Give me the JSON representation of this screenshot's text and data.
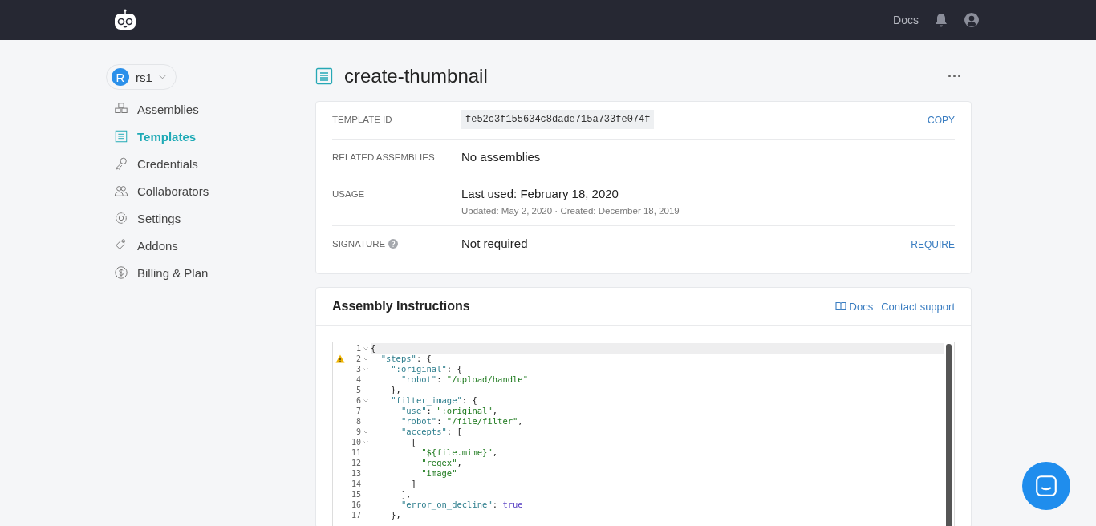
{
  "topbar": {
    "links": [
      "Docs"
    ]
  },
  "account": {
    "initial": "R",
    "name": "rs1"
  },
  "sidebar": {
    "items": [
      {
        "label": "Assemblies",
        "selected": false
      },
      {
        "label": "Templates",
        "selected": true
      },
      {
        "label": "Credentials",
        "selected": false
      },
      {
        "label": "Collaborators",
        "selected": false
      },
      {
        "label": "Settings",
        "selected": false
      },
      {
        "label": "Addons",
        "selected": false
      },
      {
        "label": "Billing & Plan",
        "selected": false
      }
    ]
  },
  "page": {
    "title": "create-thumbnail",
    "more": "···"
  },
  "details": [
    {
      "label": "TEMPLATE ID",
      "kind": "code",
      "help": false,
      "value": "fe52c3f155634c8dade715a733fe074f",
      "action": "COPY"
    },
    {
      "label": "RELATED ASSEMBLIES",
      "kind": "text",
      "help": false,
      "value": "No assemblies"
    },
    {
      "label": "USAGE",
      "kind": "text",
      "help": false,
      "value": "Last used: February 18, 2020",
      "note": "Updated: May 2, 2020 · Created: December 18, 2019"
    },
    {
      "label": "SIGNATURE",
      "kind": "text",
      "help": true,
      "value": "Not required",
      "action": "REQUIRE"
    }
  ],
  "instructions": {
    "title": "Assembly Instructions",
    "docs": "Docs",
    "support": "Contact support",
    "lines": [
      {
        "number": "1",
        "fold": true,
        "warning": false,
        "tokens": [
          {
            "kind": "punct",
            "text": "{"
          }
        ]
      },
      {
        "number": "2",
        "fold": true,
        "warning": true,
        "tokens": [
          {
            "kind": "key",
            "text": "  \"steps\""
          },
          {
            "kind": "punct",
            "text": ": {"
          }
        ]
      },
      {
        "number": "3",
        "fold": true,
        "warning": false,
        "tokens": [
          {
            "kind": "key",
            "text": "    \":original\""
          },
          {
            "kind": "punct",
            "text": ": {"
          }
        ]
      },
      {
        "number": "4",
        "fold": false,
        "warning": false,
        "tokens": [
          {
            "kind": "key",
            "text": "      \"robot\""
          },
          {
            "kind": "punct",
            "text": ": "
          },
          {
            "kind": "string",
            "text": "\"/upload/handle\""
          }
        ]
      },
      {
        "number": "5",
        "fold": false,
        "warning": false,
        "tokens": [
          {
            "kind": "punct",
            "text": "    },"
          }
        ]
      },
      {
        "number": "6",
        "fold": true,
        "warning": false,
        "tokens": [
          {
            "kind": "key",
            "text": "    \"filter_image\""
          },
          {
            "kind": "punct",
            "text": ": {"
          }
        ]
      },
      {
        "number": "7",
        "fold": false,
        "warning": false,
        "tokens": [
          {
            "kind": "key",
            "text": "      \"use\""
          },
          {
            "kind": "punct",
            "text": ": "
          },
          {
            "kind": "string",
            "text": "\":original\""
          },
          {
            "kind": "punct",
            "text": ","
          }
        ]
      },
      {
        "number": "8",
        "fold": false,
        "warning": false,
        "tokens": [
          {
            "kind": "key",
            "text": "      \"robot\""
          },
          {
            "kind": "punct",
            "text": ": "
          },
          {
            "kind": "string",
            "text": "\"/file/filter\""
          },
          {
            "kind": "punct",
            "text": ","
          }
        ]
      },
      {
        "number": "9",
        "fold": true,
        "warning": false,
        "tokens": [
          {
            "kind": "key",
            "text": "      \"accepts\""
          },
          {
            "kind": "punct",
            "text": ": ["
          }
        ]
      },
      {
        "number": "10",
        "fold": true,
        "warning": false,
        "tokens": [
          {
            "kind": "punct",
            "text": "        ["
          }
        ]
      },
      {
        "number": "11",
        "fold": false,
        "warning": false,
        "tokens": [
          {
            "kind": "string",
            "text": "          \"${file.mime}\""
          },
          {
            "kind": "punct",
            "text": ","
          }
        ]
      },
      {
        "number": "12",
        "fold": false,
        "warning": false,
        "tokens": [
          {
            "kind": "string",
            "text": "          \"regex\""
          },
          {
            "kind": "punct",
            "text": ","
          }
        ]
      },
      {
        "number": "13",
        "fold": false,
        "warning": false,
        "tokens": [
          {
            "kind": "string",
            "text": "          \"image\""
          }
        ]
      },
      {
        "number": "14",
        "fold": false,
        "warning": false,
        "tokens": [
          {
            "kind": "punct",
            "text": "        ]"
          }
        ]
      },
      {
        "number": "15",
        "fold": false,
        "warning": false,
        "tokens": [
          {
            "kind": "punct",
            "text": "      ],"
          }
        ]
      },
      {
        "number": "16",
        "fold": false,
        "warning": false,
        "tokens": [
          {
            "kind": "key",
            "text": "      \"error_on_decline\""
          },
          {
            "kind": "punct",
            "text": ": "
          },
          {
            "kind": "bool",
            "text": "true"
          }
        ]
      },
      {
        "number": "17",
        "fold": false,
        "warning": false,
        "tokens": [
          {
            "kind": "punct",
            "text": "    },"
          }
        ]
      }
    ]
  }
}
